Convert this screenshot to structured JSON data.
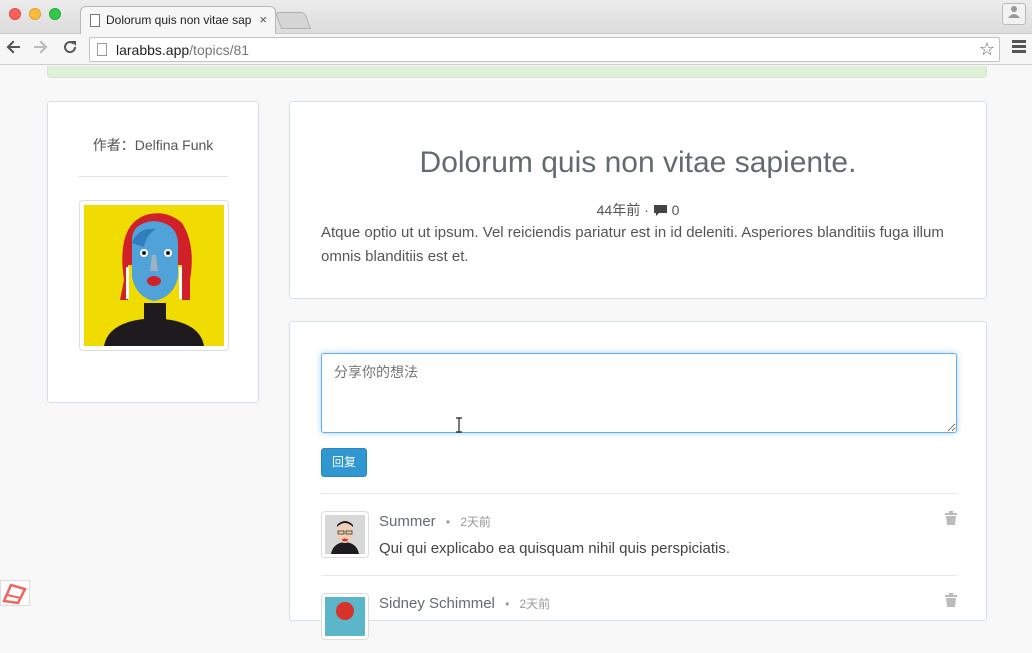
{
  "browser": {
    "tab_title": "Dolorum quis non vitae sapiente.",
    "tab_close": "×",
    "url_host": "larabbs.app",
    "url_path": "/topics/81"
  },
  "author": {
    "label": "作者：Delfina Funk"
  },
  "topic": {
    "title": "Dolorum quis non vitae sapiente.",
    "time": "44年前",
    "separator": "·",
    "comment_count": "0",
    "body": "Atque optio ut ut ipsum. Vel reiciendis pariatur est in id deleniti. Asperiores blanditiis fuga illum omnis blanditiis est et."
  },
  "reply_form": {
    "placeholder": "分享你的想法",
    "submit_label": "回复"
  },
  "replies": [
    {
      "user": "Summer",
      "dot": "•",
      "time": "2天前",
      "content": "Qui qui explicabo ea quisquam nihil quis perspiciatis."
    },
    {
      "user": "Sidney Schimmel",
      "dot": "•",
      "time": "2天前",
      "content": ""
    }
  ],
  "colors": {
    "primary": "#3097d1",
    "flash_success": "#dff0d8",
    "card_border": "#d3e0e9"
  }
}
